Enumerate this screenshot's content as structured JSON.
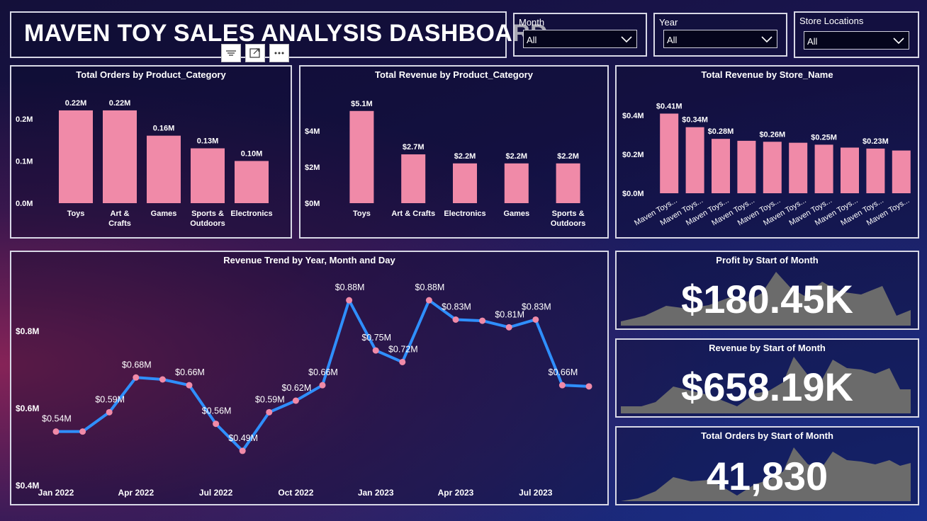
{
  "header": {
    "title": "MAVEN TOY SALES ANALYSIS DASHBOARD"
  },
  "slicers": [
    {
      "label": "Month",
      "value": "All"
    },
    {
      "label": "Year",
      "value": "All"
    },
    {
      "label": "Store Locations",
      "value": "All"
    }
  ],
  "icons": [
    "filter-lines-icon",
    "focus-mode-icon",
    "more-options-icon",
    "chevron-down-icon"
  ],
  "colors": {
    "bar": "#f08aa8",
    "line": "#2f8fff",
    "marker": "#f08aa8",
    "kpi_area": "#6b6b6b",
    "border": "#d8d8e6"
  },
  "kpis": [
    {
      "title": "Profit by Start of Month",
      "value": "$180.45K"
    },
    {
      "title": "Revenue by Start of Month",
      "value": "$658.19K"
    },
    {
      "title": "Total Orders by Start of Month",
      "value": "41,830"
    }
  ],
  "chart_data": [
    {
      "type": "bar",
      "title": "Total Orders by Product_Category",
      "categories": [
        "Toys",
        "Art & Crafts",
        "Games",
        "Sports & Outdoors",
        "Electronics"
      ],
      "category_lines": [
        [
          "Toys"
        ],
        [
          "Art &",
          "Crafts"
        ],
        [
          "Games"
        ],
        [
          "Sports &",
          "Outdoors"
        ],
        [
          "Electronics"
        ]
      ],
      "values": [
        0.22,
        0.22,
        0.16,
        0.13,
        0.1
      ],
      "data_labels": [
        "0.22M",
        "0.22M",
        "0.16M",
        "0.13M",
        "0.10M"
      ],
      "unit": "M",
      "ylim": [
        0,
        0.24
      ],
      "yticks": [
        0,
        0.1,
        0.2
      ],
      "ytick_labels": [
        "0.0M",
        "0.1M",
        "0.2M"
      ]
    },
    {
      "type": "bar",
      "title": "Total Revenue by Product_Category",
      "categories": [
        "Toys",
        "Art & Crafts",
        "Electronics",
        "Games",
        "Sports & Outdoors"
      ],
      "category_lines": [
        [
          "Toys"
        ],
        [
          "Art & Crafts"
        ],
        [
          "Electronics"
        ],
        [
          "Games"
        ],
        [
          "Sports &",
          "Outdoors"
        ]
      ],
      "values": [
        5.1,
        2.7,
        2.2,
        2.2,
        2.2
      ],
      "data_labels": [
        "$5.1M",
        "$2.7M",
        "$2.2M",
        "$2.2M",
        "$2.2M"
      ],
      "unit": "$M",
      "ylim": [
        0,
        5.6
      ],
      "yticks": [
        0,
        2,
        4
      ],
      "ytick_labels": [
        "$0M",
        "$2M",
        "$4M"
      ]
    },
    {
      "type": "bar",
      "title": "Total Revenue by Store_Name",
      "categories": [
        "Maven Toys...",
        "Maven Toys...",
        "Maven Toys...",
        "Maven Toys...",
        "Maven Toys...",
        "Maven Toys...",
        "Maven Toys...",
        "Maven Toys...",
        "Maven Toys...",
        "Maven Toys..."
      ],
      "values": [
        0.41,
        0.34,
        0.28,
        0.27,
        0.265,
        0.26,
        0.25,
        0.235,
        0.23,
        0.22
      ],
      "data_labels": [
        "$0.41M",
        "$0.34M",
        "$0.28M",
        "",
        "$0.26M",
        "",
        "$0.25M",
        "",
        "$0.23M",
        ""
      ],
      "unit": "$M",
      "ylim": [
        0,
        0.47
      ],
      "yticks": [
        0,
        0.2,
        0.4
      ],
      "ytick_labels": [
        "$0.0M",
        "$0.2M",
        "$0.4M"
      ]
    },
    {
      "type": "line",
      "title": "Revenue Trend by Year, Month and Day",
      "x": [
        "2022-01",
        "2022-02",
        "2022-03",
        "2022-04",
        "2022-05",
        "2022-06",
        "2022-07",
        "2022-08",
        "2022-09",
        "2022-10",
        "2022-11",
        "2022-12",
        "2023-01",
        "2023-02",
        "2023-03",
        "2023-04",
        "2023-05",
        "2023-06",
        "2023-07",
        "2023-08",
        "2023-09"
      ],
      "values": [
        0.54,
        0.54,
        0.59,
        0.68,
        0.675,
        0.66,
        0.56,
        0.49,
        0.59,
        0.62,
        0.66,
        0.88,
        0.75,
        0.72,
        0.88,
        0.83,
        0.827,
        0.81,
        0.83,
        0.66,
        0.657
      ],
      "data_labels": [
        "$0.54M",
        "",
        "$0.59M",
        "$0.68M",
        "",
        "$0.66M",
        "$0.56M",
        "$0.49M",
        "$0.59M",
        "$0.62M",
        "$0.66M",
        "$0.88M",
        "$0.75M",
        "$0.72M",
        "$0.88M",
        "$0.83M",
        "",
        "$0.81M",
        "$0.83M",
        "$0.66M",
        ""
      ],
      "xtick_labels": [
        {
          "index": 0,
          "label": "Jan 2022"
        },
        {
          "index": 3,
          "label": "Apr 2022"
        },
        {
          "index": 6,
          "label": "Jul 2022"
        },
        {
          "index": 9,
          "label": "Oct 2022"
        },
        {
          "index": 12,
          "label": "Jan 2023"
        },
        {
          "index": 15,
          "label": "Apr 2023"
        },
        {
          "index": 18,
          "label": "Jul 2023"
        }
      ],
      "unit": "$M",
      "ylim": [
        0.4,
        0.95
      ],
      "yticks": [
        0.4,
        0.6,
        0.8
      ],
      "ytick_labels": [
        "$0.4M",
        "$0.6M",
        "$0.8M"
      ]
    }
  ]
}
